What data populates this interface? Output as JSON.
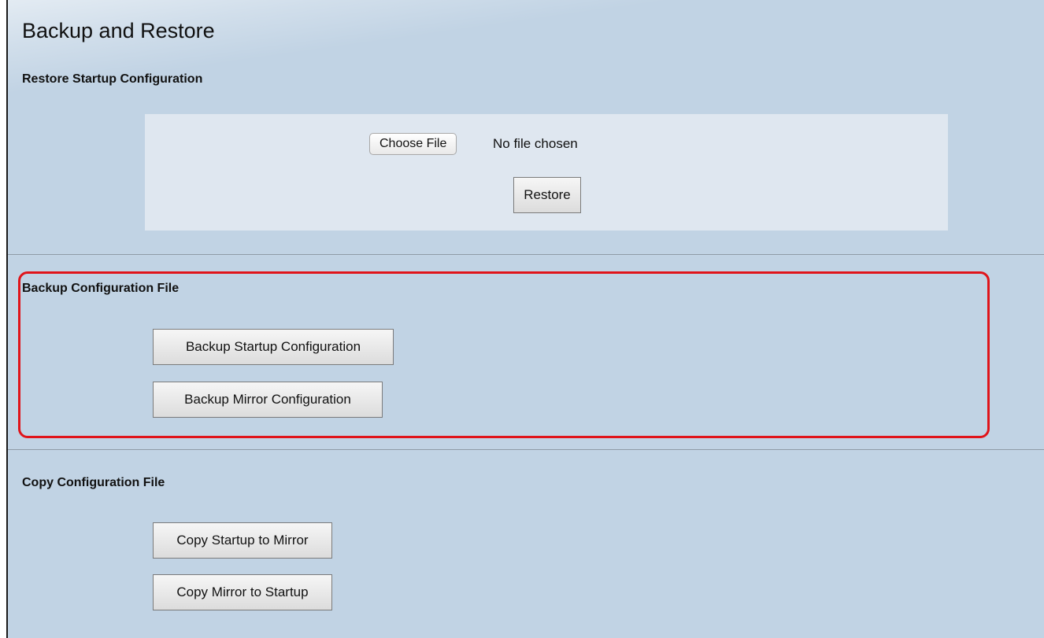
{
  "page": {
    "title": "Backup and Restore"
  },
  "restore": {
    "heading": "Restore Startup Configuration",
    "choose_file_label": "Choose File",
    "file_status": "No file chosen",
    "restore_label": "Restore"
  },
  "backup": {
    "heading": "Backup Configuration File",
    "startup_label": "Backup Startup Configuration",
    "mirror_label": "Backup Mirror Configuration"
  },
  "copy": {
    "heading": "Copy Configuration File",
    "startup_to_mirror_label": "Copy Startup to Mirror",
    "mirror_to_startup_label": "Copy Mirror to Startup"
  },
  "colors": {
    "background": "#c1d3e4",
    "panel": "#dfe7f0",
    "highlight": "#e0141a"
  }
}
